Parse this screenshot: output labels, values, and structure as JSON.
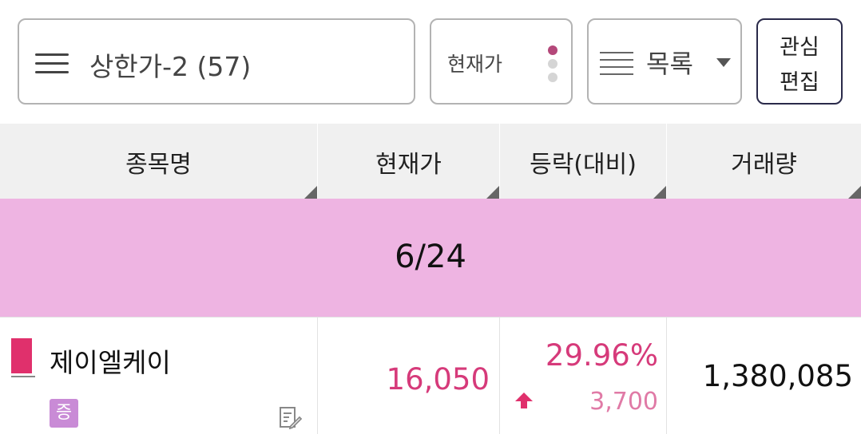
{
  "topbar": {
    "group_label": "상한가-2 (57)",
    "price_mode_label": "현재가",
    "view_mode_label": "목록",
    "edit_line1": "관심",
    "edit_line2": "편집"
  },
  "colors": {
    "date_band": "#eeb4e2",
    "up_red": "#d63a7a",
    "dot_active": "#b4487a",
    "dot_inactive": "#d5d5d5",
    "badge": "#c98bd6",
    "marker": "#e0306c"
  },
  "table": {
    "columns": [
      "종목명",
      "현재가",
      "등락(대비)",
      "거래량"
    ],
    "date_group": "6/24",
    "rows": [
      {
        "name": "제이엘케이",
        "badge": "증",
        "price": "16,050",
        "change_rate": "29.96%",
        "change_amount": "3,700",
        "volume": "1,380,085"
      }
    ]
  },
  "icons": {
    "menu": "hamburger-icon",
    "dots": "vertical-dots-icon",
    "list": "list-icon",
    "caret": "caret-down-icon",
    "sort": "sort-triangle-icon",
    "memo": "memo-edit-icon",
    "up": "up-arrow-icon"
  }
}
